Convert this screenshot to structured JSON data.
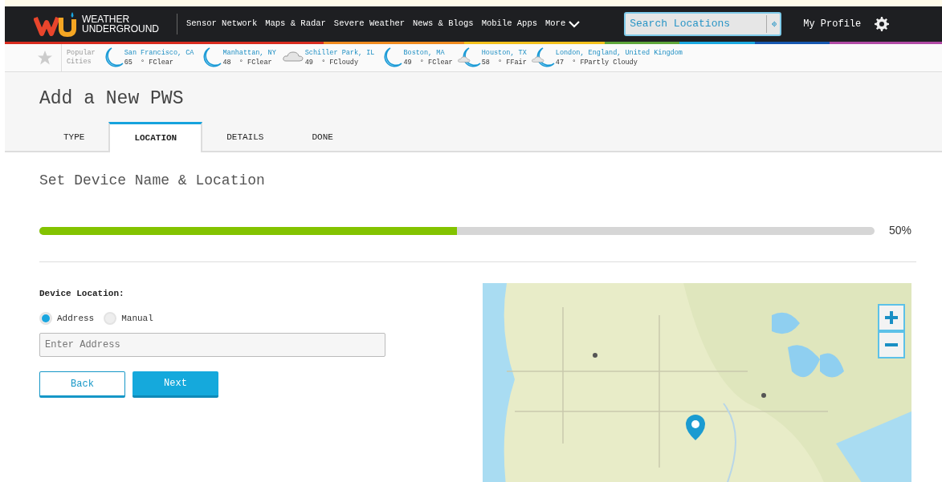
{
  "header": {
    "logo_text": [
      "WEATHER",
      "UNDERGROUND"
    ],
    "nav": [
      {
        "label": "Sensor Network",
        "dropdown": false
      },
      {
        "label": "Maps & Radar",
        "dropdown": false
      },
      {
        "label": "Severe Weather",
        "dropdown": false
      },
      {
        "label": "News & Blogs",
        "dropdown": false
      },
      {
        "label": "Mobile Apps",
        "dropdown": false
      },
      {
        "label": "More",
        "dropdown": true
      }
    ],
    "search": {
      "placeholder": "Search Locations"
    },
    "profile": "My Profile"
  },
  "popular_cities": {
    "label": [
      "Popular",
      "Cities"
    ],
    "cities": [
      {
        "name": "San Francisco, CA",
        "temp": "65",
        "unit": "° F",
        "condition": "Clear",
        "kind": "moon"
      },
      {
        "name": "Manhattan, NY",
        "temp": "48",
        "unit": "° F",
        "condition": "Clear",
        "kind": "moon"
      },
      {
        "name": "Schiller Park, IL",
        "temp": "49",
        "unit": "° F",
        "condition": "Cloudy",
        "kind": "cloud"
      },
      {
        "name": "Boston, MA",
        "temp": "49",
        "unit": "° F",
        "condition": "Clear",
        "kind": "moon"
      },
      {
        "name": "Houston, TX",
        "temp": "58",
        "unit": "° F",
        "condition": "Fair",
        "kind": "moon-cloud"
      },
      {
        "name": "London, England, United Kingdom",
        "temp": "47",
        "unit": "° F",
        "condition": "Partly Cloudy",
        "kind": "moon-cloud"
      }
    ]
  },
  "page": {
    "title": "Add a New PWS",
    "tabs": [
      {
        "label": "TYPE",
        "selected": false
      },
      {
        "label": "LOCATION",
        "selected": true
      },
      {
        "label": "DETAILS",
        "selected": false
      },
      {
        "label": "DONE",
        "selected": false
      }
    ]
  },
  "step": {
    "title": "Set Device Name & Location",
    "progress": {
      "level": 0.5,
      "reading": "50%"
    }
  },
  "form": {
    "label": "Device Location:",
    "options": [
      {
        "label": "Address",
        "selected": true
      },
      {
        "label": "Manual",
        "selected": false
      }
    ],
    "address": {
      "placeholder": "Enter Address"
    },
    "buttons": [
      {
        "label": "Back",
        "kind": "outline"
      },
      {
        "label": "Next",
        "kind": "primary"
      }
    ]
  }
}
